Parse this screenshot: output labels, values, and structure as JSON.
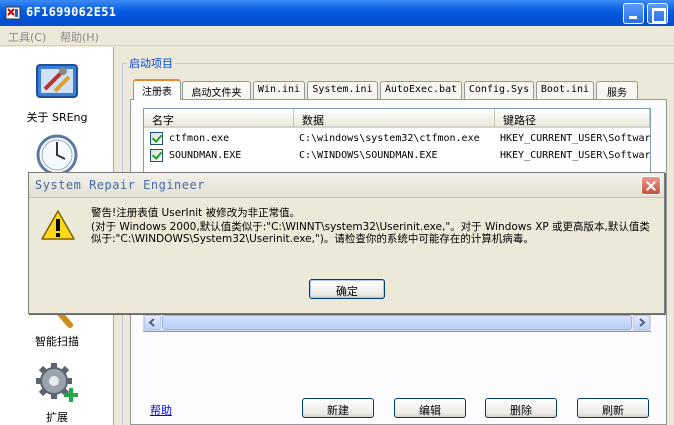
{
  "window": {
    "title": "6F1699062E51"
  },
  "menu": [
    {
      "label": "工具(C)"
    },
    {
      "label": "帮助(H)"
    }
  ],
  "nav": {
    "items": [
      {
        "label": "关于 SREng"
      },
      {
        "label": ""
      },
      {
        "label": "智能扫描"
      },
      {
        "label": "扩展"
      }
    ]
  },
  "group": {
    "title": "启动项目"
  },
  "tabs": [
    {
      "label": "注册表"
    },
    {
      "label": "启动文件夹"
    },
    {
      "label": "Win.ini"
    },
    {
      "label": "System.ini"
    },
    {
      "label": "AutoExec.bat"
    },
    {
      "label": "Config.Sys"
    },
    {
      "label": "Boot.ini"
    },
    {
      "label": "服务"
    }
  ],
  "list": {
    "columns": [
      "名字",
      "数据",
      "键路径"
    ],
    "rows": [
      {
        "name": "ctfmon.exe",
        "data": "C:\\windows\\system32\\ctfmon.exe",
        "path": "HKEY_CURRENT_USER\\Softwar"
      },
      {
        "name": "SOUNDMAN.EXE",
        "data": "C:\\WINDOWS\\SOUNDMAN.EXE",
        "path": "HKEY_CURRENT_USER\\Softwar"
      }
    ]
  },
  "footer": {
    "help": "帮助",
    "new": "新建",
    "edit": "编辑",
    "delete": "删除",
    "refresh": "刷新"
  },
  "dialog": {
    "title": "System Repair Engineer",
    "line1": "警告!注册表值 UserInit 被修改为非正常值。",
    "line2": "(对于 Windows 2000,默认值类似于:\"C:\\WINNT\\system32\\Userinit.exe,\"。对于 Windows XP 或更高版本,默认值类似于:\"C:\\WINDOWS\\System32\\Userinit.exe,\")。请检查你的系统中可能存在的计算机病毒。",
    "ok": "确定"
  }
}
